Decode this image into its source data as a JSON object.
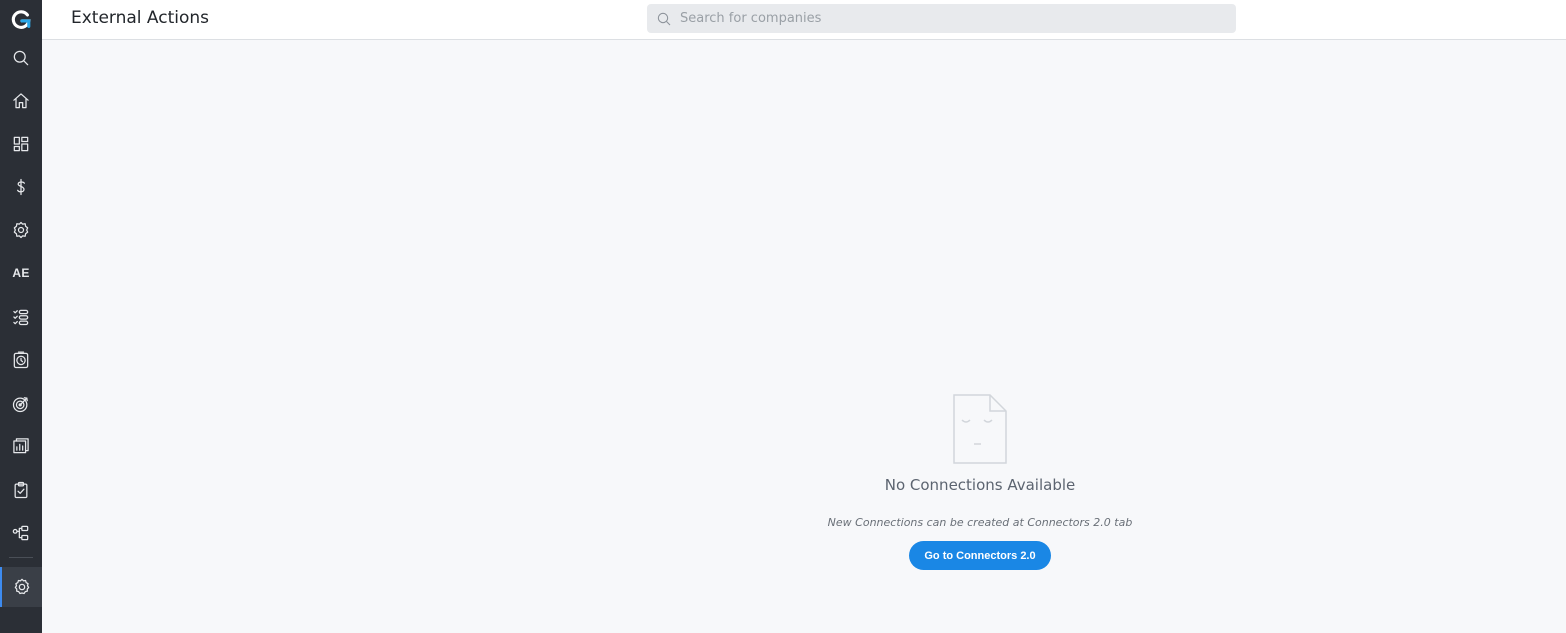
{
  "app": {
    "logo_letter": "G"
  },
  "header": {
    "title": "External Actions",
    "search_placeholder": "Search for companies"
  },
  "sidebar": {
    "items": [
      {
        "icon": "search-icon"
      },
      {
        "icon": "home-icon"
      },
      {
        "icon": "dashboard-grid-icon"
      },
      {
        "icon": "dollar-icon"
      },
      {
        "icon": "gear-badge-icon"
      },
      {
        "icon": "text-badge",
        "label": "AE"
      },
      {
        "icon": "list-check-icon"
      },
      {
        "icon": "timer-icon"
      },
      {
        "icon": "target-icon"
      },
      {
        "icon": "report-chart-icon"
      },
      {
        "icon": "clipboard-check-icon"
      },
      {
        "icon": "flow-tree-icon"
      },
      {
        "icon": "settings-gear-icon",
        "active": true
      }
    ]
  },
  "empty_state": {
    "title": "No Connections Available",
    "subtitle": "New Connections can be created at Connectors 2.0 tab",
    "button_label": "Go to Connectors 2.0"
  },
  "colors": {
    "sidebar_bg": "#2b2f36",
    "accent": "#1a87e5",
    "page_bg": "#f7f8fa"
  }
}
